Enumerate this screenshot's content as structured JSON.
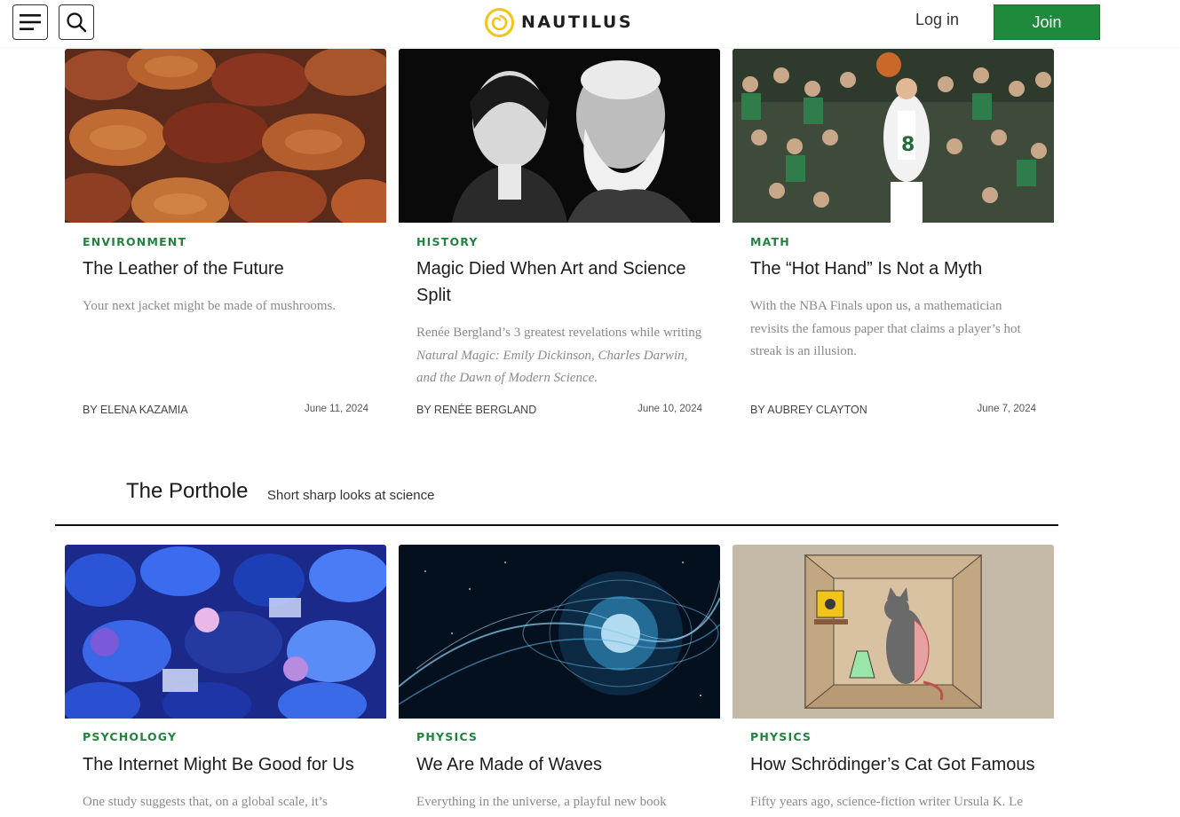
{
  "header": {
    "logo_text": "NAUTILUS",
    "login_label": "Log in",
    "join_label": "Join",
    "join_color": "#1f8a3c",
    "menu_icon": "hamburger-menu-icon",
    "search_icon": "search-icon"
  },
  "articles_top": [
    {
      "category": "ENVIRONMENT",
      "title": "The Leather of the Future",
      "dek": "Your next jacket might be made of mushrooms.",
      "byline": "BY ELENA KAZAMIA",
      "date": "June 11, 2024"
    },
    {
      "category": "HISTORY",
      "title": "Magic Died When Art and Science Split",
      "dek_plain": "Renée Bergland’s 3 greatest revelations while writing ",
      "dek_italic": "Natural Magic: Emily Dickinson, Charles Darwin, and the Dawn of Modern Science.",
      "byline": "BY RENÉE BERGLAND",
      "date": "June 10, 2024"
    },
    {
      "category": "MATH",
      "title": "The “Hot Hand” Is Not a Myth",
      "dek": "With the NBA Finals upon us, a mathematician revisits the famous paper that claims a player’s hot streak is an illusion.",
      "byline": "BY AUBREY CLAYTON",
      "date": "June 7, 2024"
    }
  ],
  "porthole": {
    "title": "The Porthole",
    "subtitle": "Short sharp looks at science"
  },
  "articles_bottom": [
    {
      "category": "PSYCHOLOGY",
      "title": "The Internet Might Be Good for Us",
      "dek": "One study suggests that, on a global scale, it’s"
    },
    {
      "category": "PHYSICS",
      "title": "We Are Made of Waves",
      "dek": "Everything in the universe, a playful new book"
    },
    {
      "category": "PHYSICS",
      "title": "How Schrödinger’s Cat Got Famous",
      "dek": "Fifty years ago, science-fiction writer Ursula K. Le"
    }
  ],
  "accent_green": "#23823e"
}
